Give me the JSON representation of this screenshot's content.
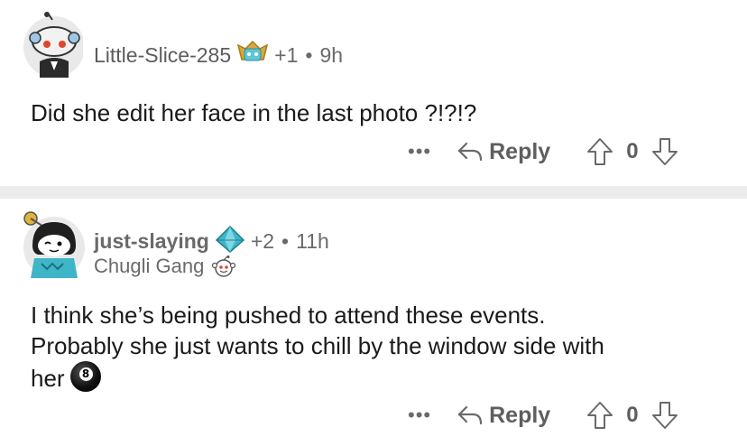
{
  "comments": [
    {
      "username": "Little-Slice-285",
      "karma": "+1",
      "separator": "•",
      "time": "9h",
      "avatar_icon": "snoo-avatar-icon",
      "badge_icon": "award-shield-icon",
      "body": "Did she edit her face in the last photo ?!?!?",
      "more": "•••",
      "reply_label": "Reply",
      "score": "0"
    },
    {
      "username": "just-slaying",
      "karma": "+2",
      "separator": "•",
      "time": "11h",
      "flair": "Chugli Gang",
      "avatar_icon": "snoo-avatar-icon",
      "badge_icon": "diamond-icon",
      "flair_icon": "snoo-face-icon",
      "body_line1": "I think she’s being pushed to attend these events.",
      "body_line2": "Probably she just wants to chill by the window side with",
      "body_line3": "her",
      "emoji": "8",
      "emoji_icon": "eight-ball-icon",
      "more": "•••",
      "reply_label": "Reply",
      "score": "0"
    }
  ],
  "colors": {
    "text": "#1a1a1a",
    "muted": "#6a6a6a",
    "divider": "#ececec",
    "badge_gold": "#d7a93b",
    "diamond_teal": "#3fb6c7"
  }
}
